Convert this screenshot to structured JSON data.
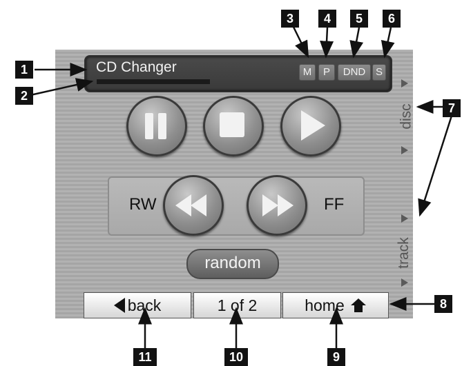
{
  "display": {
    "title": "CD Changer",
    "progress_fraction": 1.0
  },
  "indicators": [
    {
      "key": "m",
      "label": "M"
    },
    {
      "key": "p",
      "label": "P"
    },
    {
      "key": "dnd",
      "label": "DND"
    },
    {
      "key": "s",
      "label": "S"
    }
  ],
  "transport": {
    "pause_icon": "pause-icon",
    "stop_icon": "stop-icon",
    "play_icon": "play-icon",
    "rw_label": "RW",
    "ff_label": "FF",
    "random_label": "random"
  },
  "side": {
    "disc_label": "disc",
    "track_label": "track"
  },
  "bottom": {
    "back_label": "back",
    "page_label": "1 of 2",
    "home_label": "home"
  },
  "callouts": [
    "1",
    "2",
    "3",
    "4",
    "5",
    "6",
    "7",
    "8",
    "9",
    "10",
    "11"
  ],
  "colors": {
    "panel": "#ababab",
    "display": "#404040",
    "callout": "#121212"
  }
}
